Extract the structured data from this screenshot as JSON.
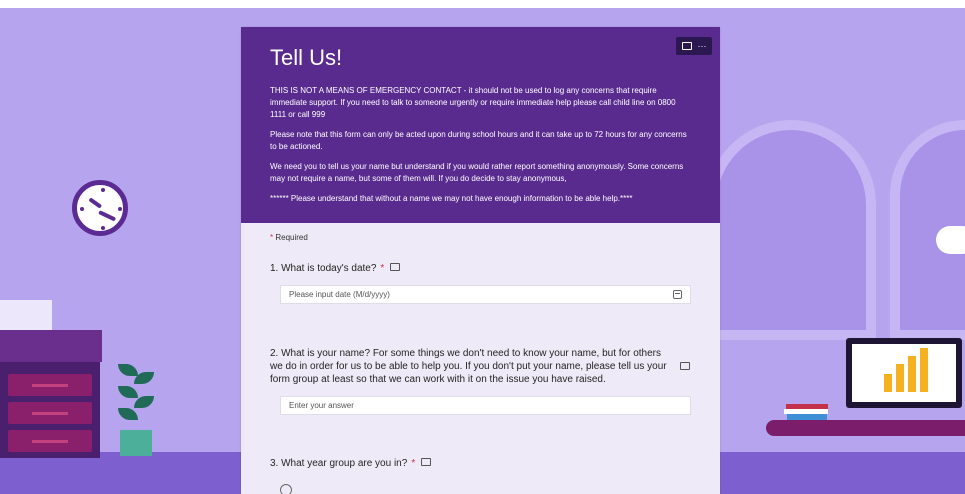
{
  "form": {
    "title": "Tell Us!",
    "header_paragraphs": [
      "THIS IS NOT A MEANS OF EMERGENCY CONTACT - it should not be used to log any concerns that require immediate support. If you need to talk to someone urgently or require immediate help please call child line on 0800 1111 or call 999",
      "Please note that this form can only be acted upon during school hours and it can take up to 72 hours for any concerns to be actioned.",
      "We need you to tell us your name but understand if you would rather report something anonymously. Some concerns may not require a name, but some of them will. If you do decide to stay anonymous,",
      "****** Please understand that without a name we may not have enough information to be able help.****"
    ],
    "more_label": "···",
    "required_label": "Required",
    "required_star": "*",
    "questions": [
      {
        "text": "1. What is today's date?",
        "star": "*",
        "placeholder": "Please input date (M/d/yyyy)"
      },
      {
        "text": "2. What is your name? For some things we don't need to know your name, but for others we do in order for us to be able to help you. If you don't put your name, please tell us your form group at least so that we can work with it on the issue you have raised.",
        "placeholder": "Enter your answer"
      },
      {
        "text": "3. What year group are you in?",
        "star": "*"
      }
    ]
  },
  "colors": {
    "header": "#5a2b8f",
    "background": "#b7a4ee",
    "required_star": "#c4314b"
  },
  "icons": [
    "immersive-reader-icon",
    "more-icon",
    "calendar-icon",
    "clock-icon"
  ]
}
